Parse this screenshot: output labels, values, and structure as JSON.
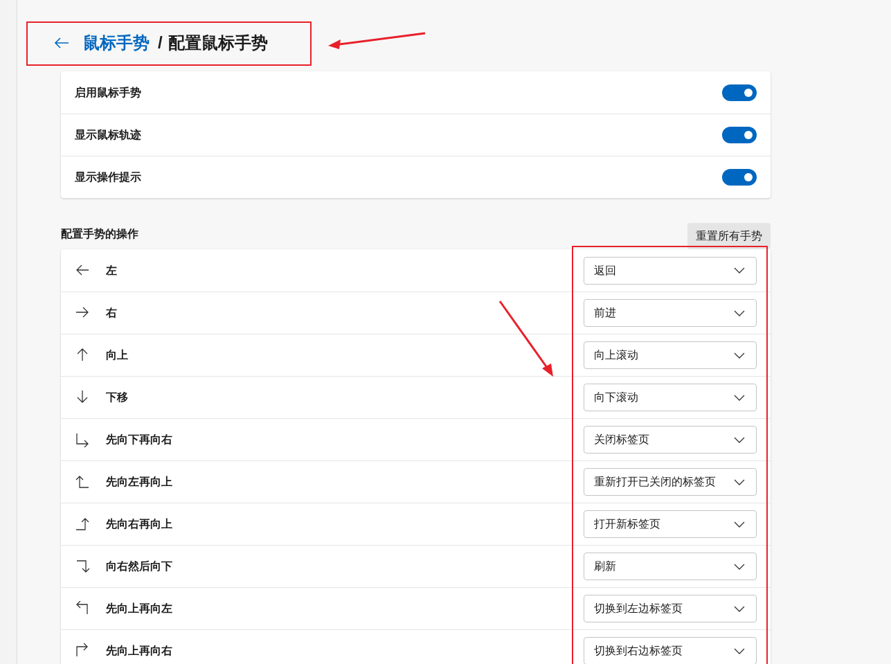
{
  "header": {
    "back_link": "鼠标手势",
    "separator": "/",
    "title": "配置鼠标手势"
  },
  "toggles": [
    {
      "label": "启用鼠标手势",
      "on": true
    },
    {
      "label": "显示鼠标轨迹",
      "on": true
    },
    {
      "label": "显示操作提示",
      "on": true
    }
  ],
  "section": {
    "title": "配置手势的操作",
    "reset_button": "重置所有手势"
  },
  "gestures": [
    {
      "kind": "left",
      "label": "左",
      "action": "返回"
    },
    {
      "kind": "right",
      "label": "右",
      "action": "前进"
    },
    {
      "kind": "up",
      "label": "向上",
      "action": "向上滚动"
    },
    {
      "kind": "down",
      "label": "下移",
      "action": "向下滚动"
    },
    {
      "kind": "down-right",
      "label": "先向下再向右",
      "action": "关闭标签页"
    },
    {
      "kind": "left-up",
      "label": "先向左再向上",
      "action": "重新打开已关闭的标签页"
    },
    {
      "kind": "right-up",
      "label": "先向右再向上",
      "action": "打开新标签页"
    },
    {
      "kind": "right-down",
      "label": "向右然后向下",
      "action": "刷新"
    },
    {
      "kind": "up-left",
      "label": "先向上再向左",
      "action": "切换到左边标签页"
    },
    {
      "kind": "up-right",
      "label": "先向上再向右",
      "action": "切换到右边标签页"
    }
  ]
}
